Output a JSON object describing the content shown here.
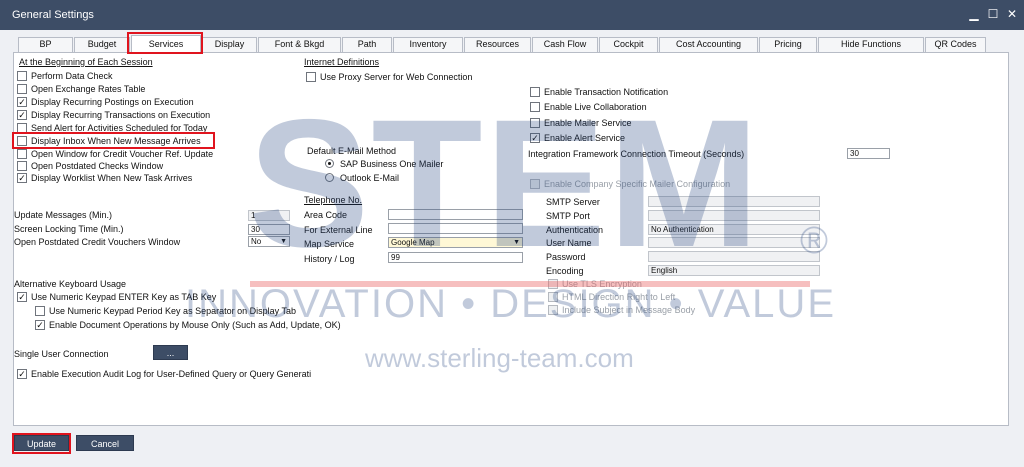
{
  "window": {
    "title": "General Settings",
    "minimize": "▁",
    "maximize": "☐",
    "close": "✕"
  },
  "tabs": [
    "BP",
    "Budget",
    "Services",
    "Display",
    "Font & Bkgd",
    "Path",
    "Inventory",
    "Resources",
    "Cash Flow",
    "Cockpit",
    "Cost Accounting",
    "Pricing",
    "Hide Functions",
    "QR Codes"
  ],
  "active_tab": "Services",
  "beginning": {
    "title": "At the Beginning of Each Session",
    "items": [
      {
        "label": "Perform Data Check",
        "checked": false
      },
      {
        "label": "Open Exchange Rates Table",
        "checked": false
      },
      {
        "label": "Display Recurring Postings on Execution",
        "checked": true
      },
      {
        "label": "Display Recurring Transactions on Execution",
        "checked": true
      },
      {
        "label": "Send Alert for Activities Scheduled for Today",
        "checked": false
      },
      {
        "label": "Display Inbox When New Message Arrives",
        "checked": false
      },
      {
        "label": "Open Window for Credit Voucher Ref. Update",
        "checked": false
      },
      {
        "label": "Open Postdated Checks Window",
        "checked": false
      },
      {
        "label": "Display Worklist When New Task Arrives",
        "checked": true
      }
    ]
  },
  "internet": {
    "title": "Internet Definitions",
    "proxy": "Use Proxy Server for Web Connection"
  },
  "right_checks": [
    {
      "label": "Enable Transaction Notification",
      "checked": false
    },
    {
      "label": "Enable Live Collaboration",
      "checked": false
    },
    {
      "label": "Enable Mailer Service",
      "checked": false
    },
    {
      "label": "Enable Alert Service",
      "checked": true
    }
  ],
  "timeout": {
    "label": "Integration Framework Connection Timeout (Seconds)",
    "value": "30"
  },
  "email": {
    "title": "Default E-Mail Method",
    "opt1": "SAP Business One Mailer",
    "opt2": "Outlook E-Mail"
  },
  "company_mailer": "Enable Company Specific Mailer Configuration",
  "mailer_fields": [
    {
      "label": "SMTP Server",
      "value": ""
    },
    {
      "label": "SMTP Port",
      "value": ""
    },
    {
      "label": "Authentication",
      "value": "No Authentication"
    },
    {
      "label": "User Name",
      "value": ""
    },
    {
      "label": "Password",
      "value": ""
    },
    {
      "label": "Encoding",
      "value": "English"
    }
  ],
  "mailer_checks": [
    "Use TLS Encryption",
    "HTML Direction Right to Left",
    "Include Subject in Message Body"
  ],
  "telephone": {
    "title": "Telephone No.",
    "area_code": "Area Code",
    "external": "For External Line",
    "map_service": "Map Service",
    "map_value": "Google Map",
    "history": "History / Log",
    "history_value": "99"
  },
  "update_msgs": {
    "label": "Update Messages (Min.)",
    "value": "1"
  },
  "screen_lock": {
    "label": "Screen Locking Time (Min.)",
    "value": "30"
  },
  "postdated": {
    "label": "Open Postdated Credit Vouchers Window",
    "value": "No"
  },
  "keyboard": {
    "title": "Alternative Keyboard Usage",
    "enter_tab": "Use Numeric Keypad ENTER Key as TAB Key",
    "period_sep": "Use Numeric Keypad Period Key as Separator on Display Tab",
    "mouse_only": "Enable Document Operations by Mouse Only (Such as Add, Update, OK)"
  },
  "single_user": {
    "label": "Single User Connection",
    "button": "..."
  },
  "audit": "Enable Execution Audit Log for User-Defined Query or Query Generati",
  "buttons": {
    "update": "Update",
    "cancel": "Cancel"
  },
  "watermark": {
    "big": "STEM",
    "reg": "®",
    "sub": "INNOVATION • DESIGN • VALUE",
    "url": "www.sterling-team.com"
  },
  "colors": {
    "accent": "#3d4d66",
    "highlight": "#e0141e"
  }
}
